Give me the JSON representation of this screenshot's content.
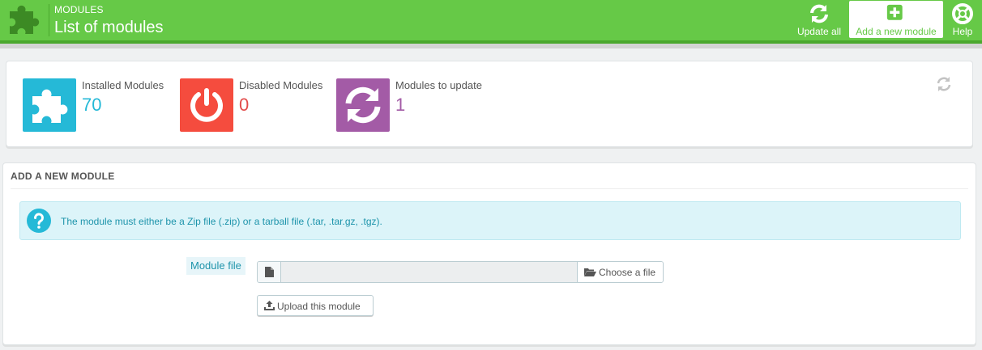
{
  "header": {
    "breadcrumb": "MODULES",
    "title": "List of modules",
    "toolbar": {
      "update_all": "Update all",
      "add_module": "Add a new module",
      "help": "Help"
    },
    "logo_icon": "puzzle-icon"
  },
  "kpis": [
    {
      "label": "Installed Modules",
      "value": "70",
      "icon": "puzzle-icon",
      "color": "#25b9d7"
    },
    {
      "label": "Disabled Modules",
      "value": "0",
      "icon": "power-icon",
      "color": "#f54c3e"
    },
    {
      "label": "Modules to update",
      "value": "1",
      "icon": "refresh-icon",
      "color": "#a35ba6"
    }
  ],
  "add_panel": {
    "heading": "ADD A NEW MODULE",
    "alert": "The module must either be a Zip file (.zip) or a tarball file (.tar, .tar.gz, .tgz).",
    "field_label": "Module file",
    "file_value": "",
    "choose_label": "Choose a file",
    "upload_label": "Upload this module"
  },
  "colors": {
    "header": "#66c947",
    "accent": "#25b9d7"
  }
}
